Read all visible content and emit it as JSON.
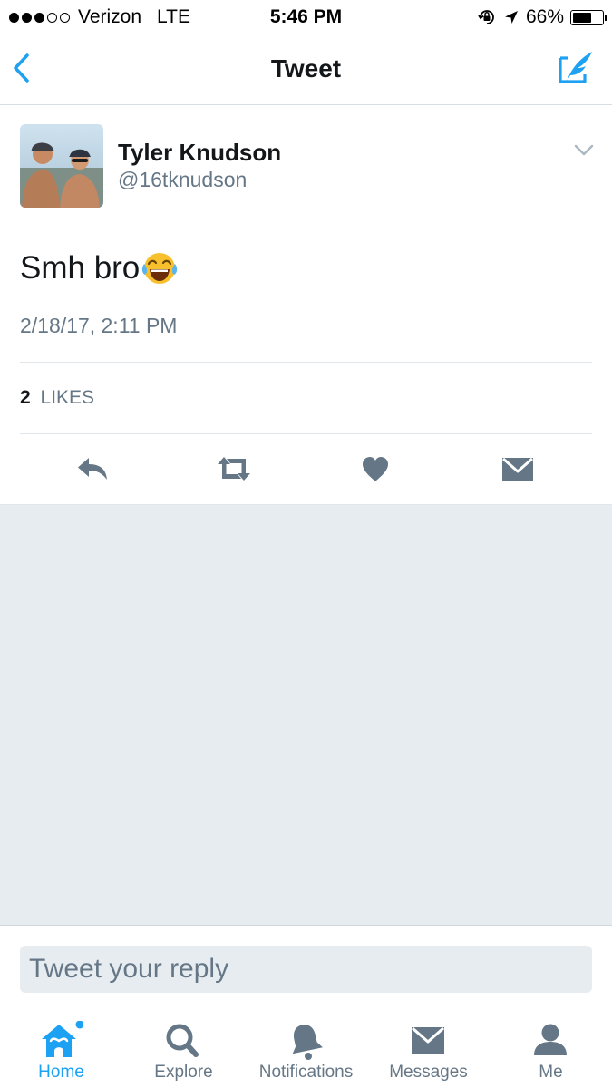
{
  "status_bar": {
    "signal_dots_filled": 3,
    "signal_dots_total": 5,
    "carrier": "Verizon",
    "network": "LTE",
    "time": "5:46 PM",
    "battery_percent": "66%",
    "battery_level": 0.66
  },
  "nav": {
    "title": "Tweet",
    "back_icon": "chevron-left-icon",
    "compose_icon": "compose-tweet-icon",
    "accent_color": "#1da1f2"
  },
  "tweet": {
    "author_name": "Tyler Knudson",
    "author_handle": "@16tknudson",
    "text": "Smh bro",
    "emoji": "face-with-tears-of-joy",
    "timestamp": "2/18/17, 2:11 PM",
    "likes_count": "2",
    "likes_label": "LIKES",
    "actions": [
      "reply-icon",
      "retweet-icon",
      "like-icon",
      "direct-message-icon"
    ]
  },
  "reply": {
    "placeholder": "Tweet your reply"
  },
  "tabs": [
    {
      "label": "Home",
      "icon": "home-icon",
      "active": true
    },
    {
      "label": "Explore",
      "icon": "search-icon",
      "active": false
    },
    {
      "label": "Notifications",
      "icon": "bell-icon",
      "active": false
    },
    {
      "label": "Messages",
      "icon": "envelope-icon",
      "active": false
    },
    {
      "label": "Me",
      "icon": "profile-icon",
      "active": false
    }
  ],
  "colors": {
    "accent": "#1da1f2",
    "secondary_text": "#657786",
    "icon_grey": "#657786",
    "background_grey": "#e6ecf0"
  }
}
